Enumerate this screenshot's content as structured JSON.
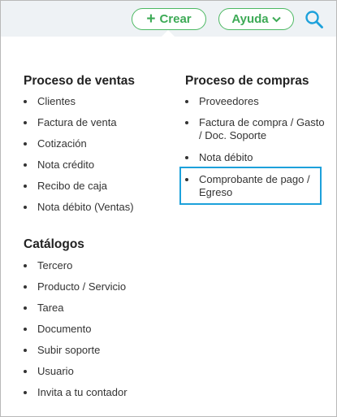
{
  "topbar": {
    "create_label": "Crear",
    "help_label": "Ayuda"
  },
  "menu": {
    "sales": {
      "title": "Proceso de ventas",
      "items": [
        "Clientes",
        "Factura de venta",
        "Cotización",
        "Nota crédito",
        "Recibo de caja",
        "Nota débito (Ventas)"
      ]
    },
    "purchases": {
      "title": "Proceso de compras",
      "items": [
        {
          "line1": "Proveedores",
          "line2": ""
        },
        {
          "line1": "Factura de compra / Gasto",
          "line2": "/ Doc. Soporte"
        },
        {
          "line1": "Nota débito",
          "line2": ""
        },
        {
          "line1": "Comprobante de pago /",
          "line2": "Egreso"
        }
      ]
    },
    "catalogs": {
      "title": "Catálogos",
      "items": [
        "Tercero",
        "Producto / Servicio",
        "Tarea",
        "Documento",
        "Subir soporte",
        "Usuario",
        "Invita a tu contador"
      ]
    }
  },
  "colors": {
    "accent_green": "#3daa56",
    "highlight_blue": "#1da1db",
    "topbar_bg": "#eef2f5"
  }
}
